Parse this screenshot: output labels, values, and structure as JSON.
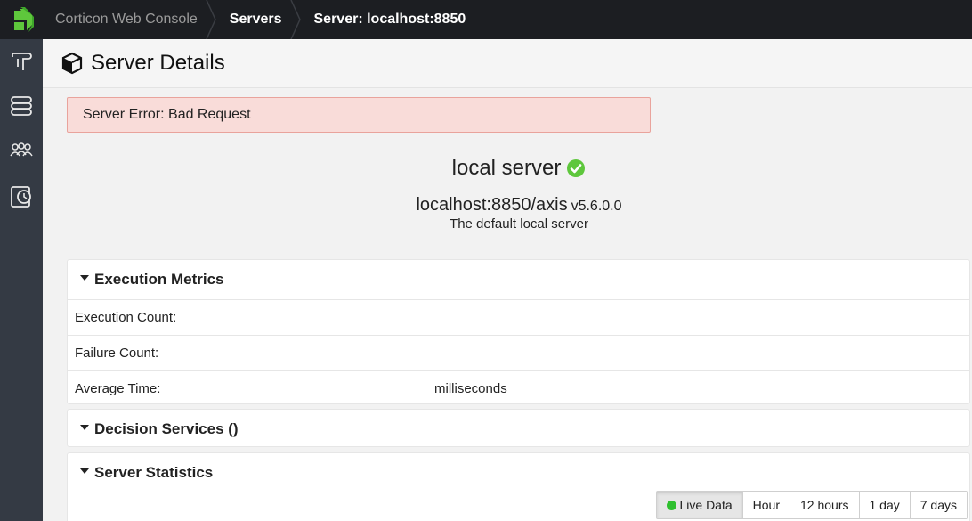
{
  "topbar": {
    "app_name": "Corticon Web Console",
    "crumb_servers": "Servers",
    "crumb_current": "Server: localhost:8850"
  },
  "sidebar": {
    "items": [
      {
        "icon": "decision-tree-icon"
      },
      {
        "icon": "servers-icon"
      },
      {
        "icon": "users-icon"
      },
      {
        "icon": "monitor-clock-icon"
      }
    ]
  },
  "page": {
    "title": "Server Details",
    "title_icon": "cube-icon"
  },
  "alert": {
    "text": "Server Error: Bad Request"
  },
  "server": {
    "name": "local server",
    "url": "localhost:8850/axis",
    "version": "v5.6.0.0",
    "description": "The default local server",
    "status_icon": "check-circle-icon"
  },
  "metrics": {
    "title": "Execution Metrics",
    "rows": [
      {
        "label": "Execution Count:",
        "unit": ""
      },
      {
        "label": "Failure Count:",
        "unit": ""
      },
      {
        "label": "Average Time:",
        "unit": "milliseconds"
      }
    ]
  },
  "decisions": {
    "title": "Decision Services ()"
  },
  "stats": {
    "title": "Server Statistics",
    "ranges": [
      "Live Data",
      "Hour",
      "12 hours",
      "1 day",
      "7 days"
    ],
    "active_range": "Live Data"
  },
  "colors": {
    "topbar_bg": "#1c1e22",
    "sidebar_bg": "#343a44",
    "brand_green": "#5ec73c",
    "alert_bg": "#f9dcd9",
    "alert_border": "#e9a39c",
    "live_green": "#2fc02f"
  }
}
